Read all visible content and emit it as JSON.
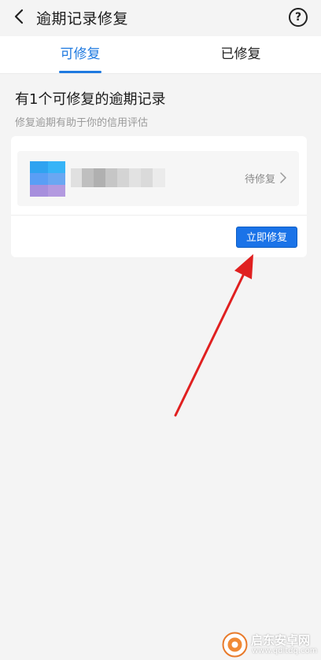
{
  "header": {
    "title": "逾期记录修复",
    "back_icon": "chevron-left-icon",
    "help_icon": "?"
  },
  "tabs": [
    {
      "label": "可修复",
      "active": true
    },
    {
      "label": "已修复",
      "active": false
    }
  ],
  "summary": {
    "title": "有1个可修复的逾期记录",
    "subtitle": "修复逾期有助于你的信用评估"
  },
  "record": {
    "status": "待修复"
  },
  "actions": {
    "repair_label": "立即修复"
  },
  "watermark": {
    "name": "启东安卓网",
    "url": "www.qdltdq.com"
  },
  "colors": {
    "accent": "#1f7ae0",
    "button": "#1a73e8",
    "annotation_arrow": "#e02020",
    "background": "#f4f4f4"
  }
}
